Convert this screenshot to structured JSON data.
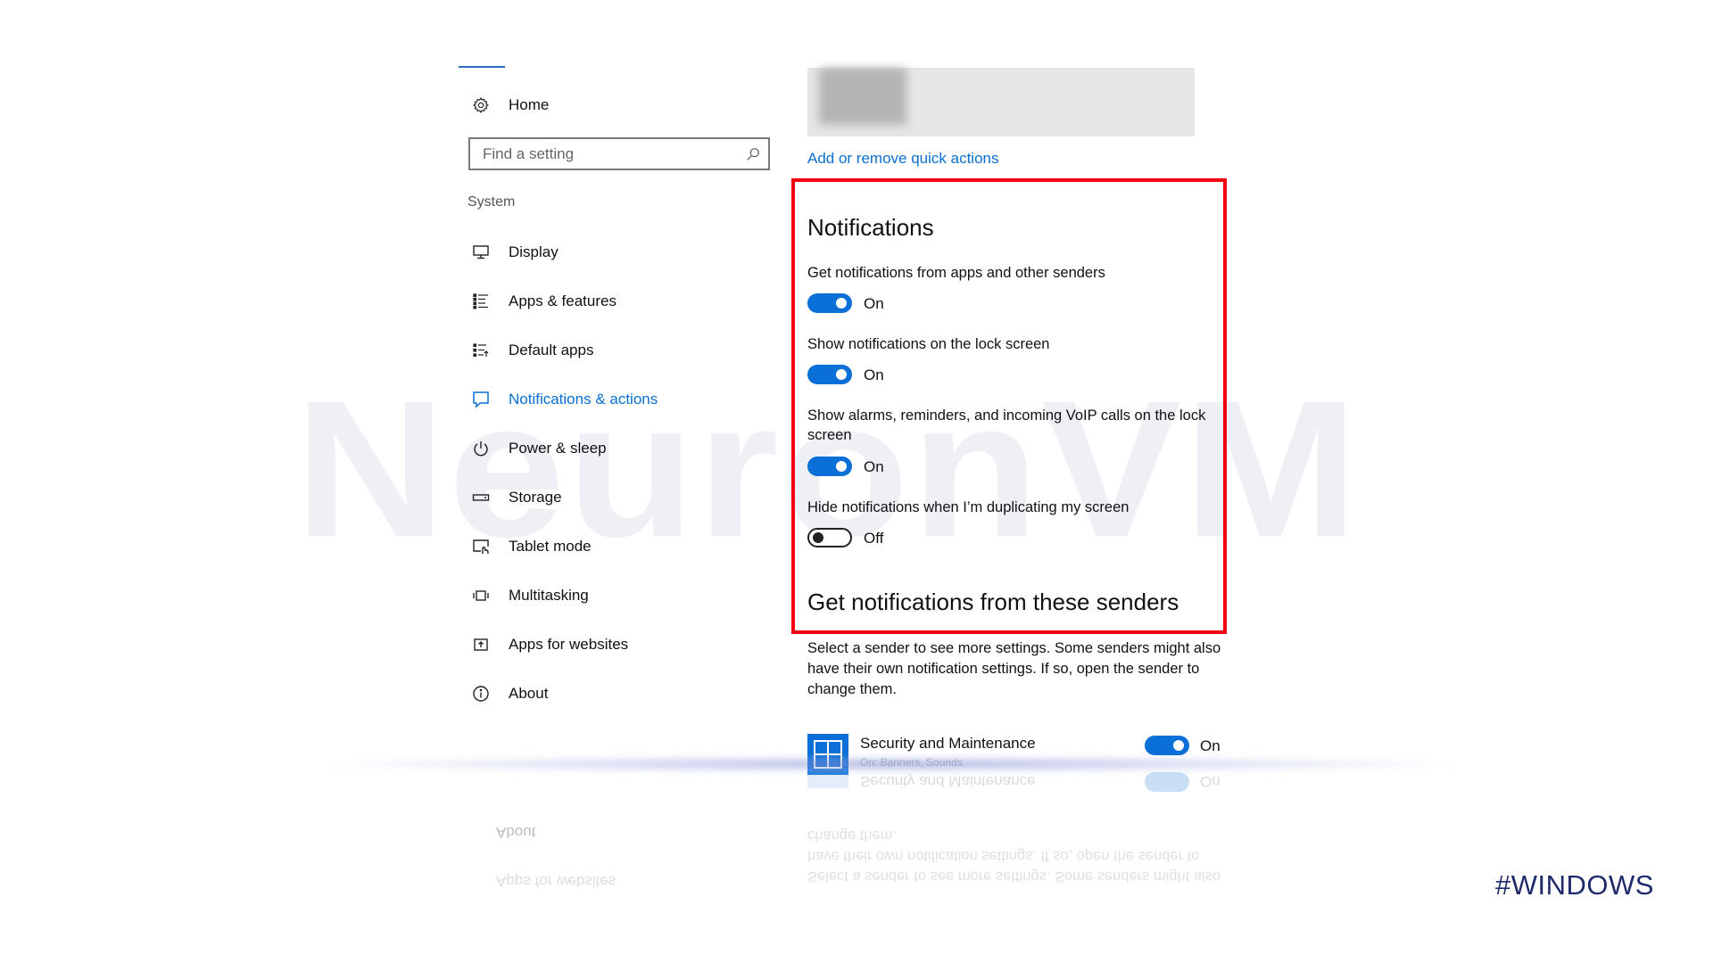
{
  "watermark": "NeuronVM",
  "brand_tag": "#WINDOWS",
  "sidebar": {
    "home_label": "Home",
    "search": {
      "placeholder": "Find a setting",
      "value": ""
    },
    "section_label": "System",
    "items": [
      {
        "label": "Display",
        "icon": "display-icon",
        "active": false
      },
      {
        "label": "Apps & features",
        "icon": "apps-list-icon",
        "active": false
      },
      {
        "label": "Default apps",
        "icon": "default-apps-icon",
        "active": false
      },
      {
        "label": "Notifications & actions",
        "icon": "notification-icon",
        "active": true
      },
      {
        "label": "Power & sleep",
        "icon": "power-icon",
        "active": false
      },
      {
        "label": "Storage",
        "icon": "storage-icon",
        "active": false
      },
      {
        "label": "Tablet mode",
        "icon": "tablet-mode-icon",
        "active": false
      },
      {
        "label": "Multitasking",
        "icon": "multitasking-icon",
        "active": false
      },
      {
        "label": "Apps for websites",
        "icon": "apps-for-websites-icon",
        "active": false
      },
      {
        "label": "About",
        "icon": "info-icon",
        "active": false
      }
    ]
  },
  "main": {
    "quick_actions_link": "Add or remove quick actions",
    "notifications": {
      "heading": "Notifications",
      "options": [
        {
          "label": "Get notifications from apps and other senders",
          "state": "On",
          "on": true
        },
        {
          "label": "Show notifications on the lock screen",
          "state": "On",
          "on": true
        },
        {
          "label": "Show alarms, reminders, and incoming VoIP calls on the lock screen",
          "state": "On",
          "on": true
        },
        {
          "label": "Hide notifications when I’m duplicating my screen",
          "state": "Off",
          "on": false
        }
      ]
    },
    "senders": {
      "heading": "Get notifications from these senders",
      "description": "Select a sender to see more settings. Some senders might also have their own notification settings. If so, open the sender to change them.",
      "items": [
        {
          "name": "Security and Maintenance",
          "subtitle": "On: Banners, Sounds",
          "state": "On",
          "on": true
        }
      ]
    }
  },
  "colors": {
    "accent": "#0a6fd6",
    "highlight_box": "#f00010",
    "brand_tag": "#1f2a6b",
    "watermark": "#eef0f5"
  }
}
